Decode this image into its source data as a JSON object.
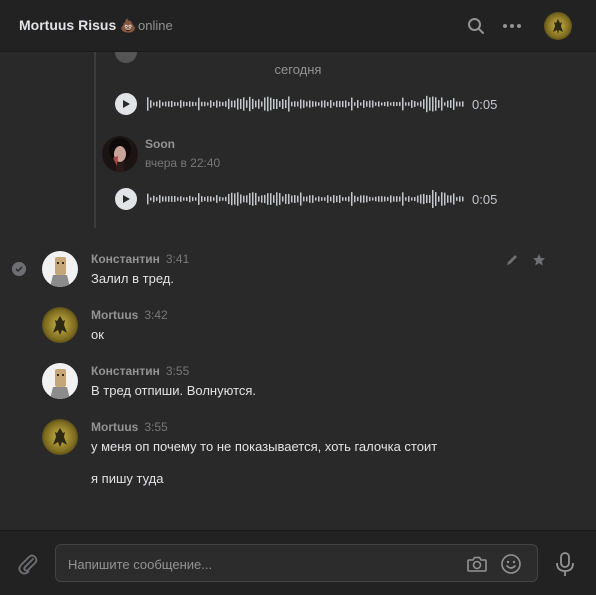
{
  "header": {
    "title": "Mortuus Risus",
    "title_emoji": "💩",
    "status": "online",
    "icons": [
      "search-icon",
      "more-icon",
      "avatar"
    ]
  },
  "thread": {
    "date_separator": "сегодня",
    "top_voice": {
      "duration": "0:05"
    },
    "reply": {
      "author": "Soon",
      "timestamp": "вчера в 22:40",
      "voice_duration": "0:05"
    }
  },
  "messages": [
    {
      "author": "Константин",
      "time": "3:41",
      "lines": [
        "Залил в тред."
      ]
    },
    {
      "author": "Mortuus",
      "time": "3:42",
      "lines": [
        "ок"
      ]
    },
    {
      "author": "Константин",
      "time": "3:55",
      "lines": [
        "В тред отпиши. Волнуются."
      ]
    },
    {
      "author": "Mortuus",
      "time": "3:55",
      "lines": [
        "у меня оп почему то не показывается, хоть галочка стоит",
        "я пишу туда"
      ]
    }
  ],
  "composer": {
    "placeholder": "Напишите сообщение..."
  },
  "colors": {
    "background": "#292929",
    "header": "#222222",
    "text": "#e1e3e6",
    "muted": "#939393"
  }
}
